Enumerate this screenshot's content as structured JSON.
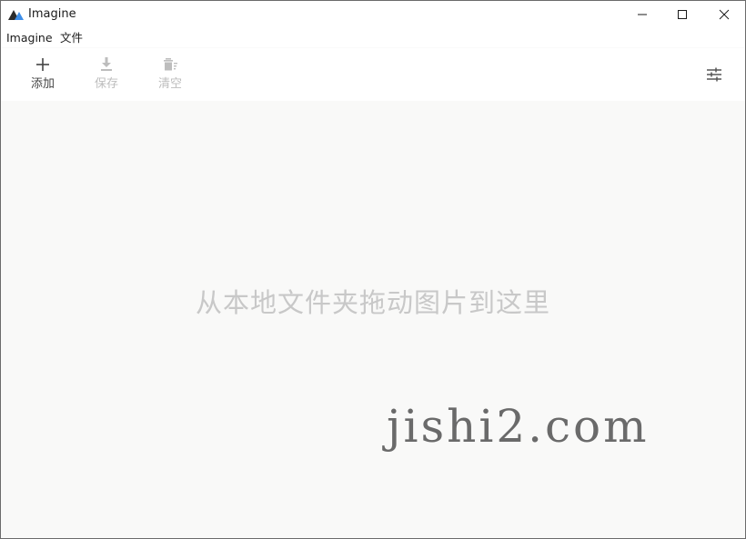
{
  "window": {
    "title": "Imagine"
  },
  "menu": {
    "items": [
      {
        "label": "Imagine"
      },
      {
        "label": "文件"
      }
    ]
  },
  "toolbar": {
    "add_label": "添加",
    "save_label": "保存",
    "clear_label": "清空"
  },
  "icons": {
    "app": "mountain-icon",
    "add": "plus-icon",
    "save": "download-icon",
    "clear": "trash-icon",
    "settings": "sliders-icon"
  },
  "colors": {
    "accent": "#3d8ee8",
    "disabled": "#bdbdbd",
    "background": "#f9f9f8"
  },
  "content": {
    "drop_hint": "从本地文件夹拖动图片到这里"
  },
  "watermark": {
    "text": "jishi2.com"
  }
}
